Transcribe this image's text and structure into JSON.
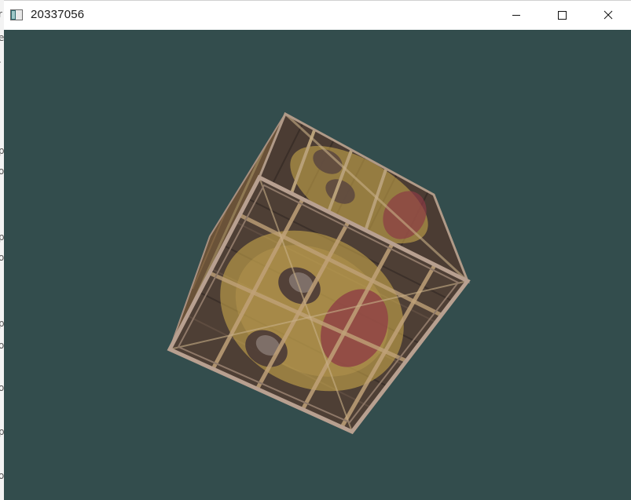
{
  "window": {
    "title": "20337056",
    "clear_color": "#334d4d",
    "controls": {
      "minimize": "minimize-icon",
      "maximize": "maximize-icon",
      "close": "close-icon"
    }
  },
  "scene": {
    "object": "textured-cube",
    "texture": "wooden-crate-with-smiley-overlay",
    "colors": {
      "wood_dark": "#4a3a30",
      "wood_light": "#8a7058",
      "frame": "#b09a88",
      "overlay_yellow": "#d4b04c",
      "overlay_red": "#8c3a44"
    }
  }
}
